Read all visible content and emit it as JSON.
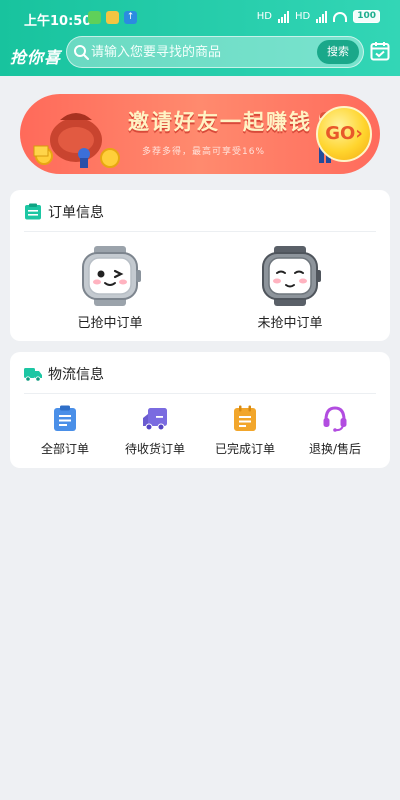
{
  "status_bar": {
    "time": "上午10:50",
    "battery": "100",
    "signal_1": "HD",
    "signal_2": "HD"
  },
  "header": {
    "logo_text": "抢你喜",
    "search_placeholder": "请输入您要寻找的商品",
    "search_button": "搜索"
  },
  "banner": {
    "title": "邀请好友一起赚钱",
    "subtitle": "多荐多得，最高可享受16%",
    "go_label": "GO›"
  },
  "orders_card": {
    "title": "订单信息",
    "items": [
      {
        "label": "已抢中订单"
      },
      {
        "label": "未抢中订单"
      }
    ]
  },
  "logistics_card": {
    "title": "物流信息",
    "items": [
      {
        "label": "全部订单",
        "icon": "clipboard-icon",
        "color": "#4a8fe8"
      },
      {
        "label": "待收货订单",
        "icon": "delivery-truck-icon",
        "color": "#7a6be0"
      },
      {
        "label": "已完成订单",
        "icon": "completed-doc-icon",
        "color": "#f2a62b"
      },
      {
        "label": "退换/售后",
        "icon": "headset-icon",
        "color": "#b24de0"
      }
    ]
  },
  "colors": {
    "accent": "#1cc6a3",
    "banner": "#ff6b5c",
    "background": "#eef0f3"
  }
}
